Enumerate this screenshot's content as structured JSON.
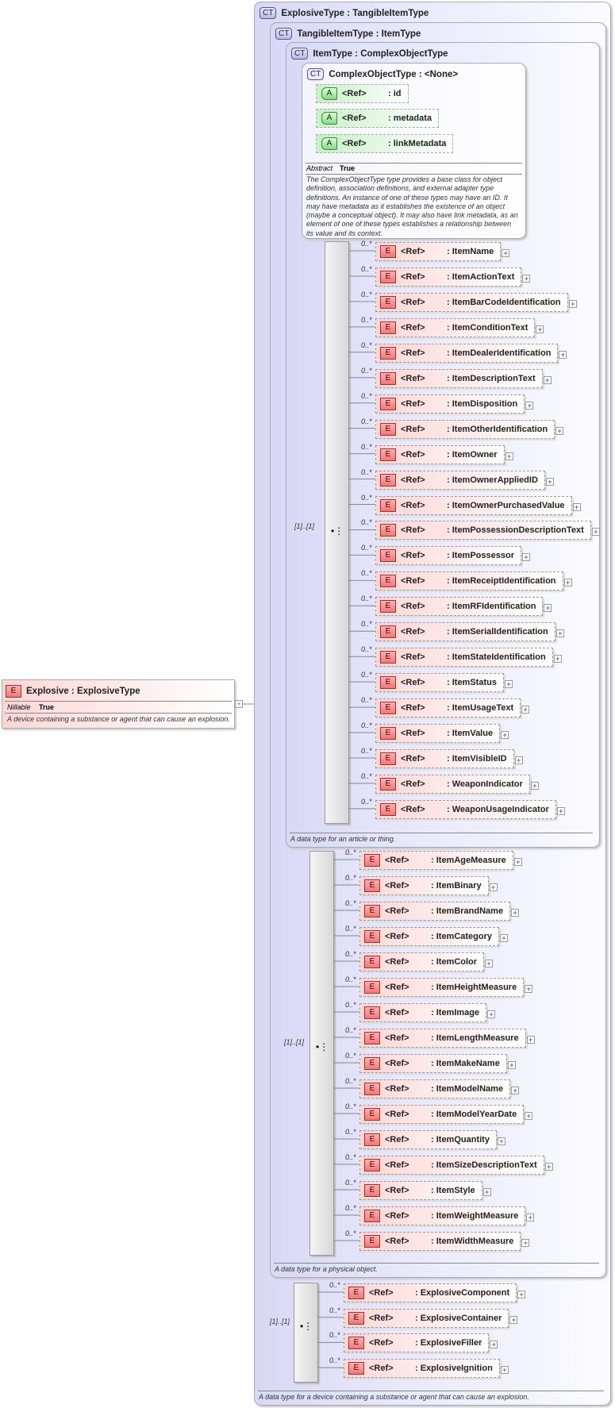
{
  "root_element": {
    "badge": "E",
    "name": "Explosive",
    "type": "ExplosiveType",
    "prop_label": "Nillable",
    "prop_value": "True",
    "description": "A device containing a substance or agent that can cause an explosion."
  },
  "explosive_type": {
    "badge": "CT",
    "title": "ExplosiveType : TangibleItemType",
    "description": "A data type for a device containing a substance or agent that can cause an explosion."
  },
  "tangible_item_type": {
    "badge": "CT",
    "title": "TangibleItemType : ItemType",
    "description": "A data type for a physical object."
  },
  "item_type": {
    "badge": "CT",
    "title": "ItemType : ComplexObjectType",
    "description": "A data type for an article or thing."
  },
  "complex_object_type": {
    "badge": "CT",
    "title": "ComplexObjectType : <None>",
    "prop_label": "Abstract",
    "prop_value": "True",
    "description": "The ComplexObjectType type provides a base class for object definition, association definitions, and external adapter type definitions. An instance of one of these types may have an ID. It may have metadata as it establishes the existence of an object (maybe a conceptual object). It may also have link metadata, as an element of one of these types establishes a relationship between its value and its context.",
    "attributes": [
      {
        "badge": "A",
        "ref": "<Ref>",
        "name": ": id"
      },
      {
        "badge": "A",
        "ref": "<Ref>",
        "name": ": metadata"
      },
      {
        "badge": "A",
        "ref": "<Ref>",
        "name": ": linkMetadata"
      }
    ]
  },
  "sequence_label": "[1]..[1]",
  "cardinality": "0..*",
  "ref_label": "<Ref>",
  "item_elements": [
    "ItemName",
    "ItemActionText",
    "ItemBarCodeIdentification",
    "ItemConditionText",
    "ItemDealerIdentification",
    "ItemDescriptionText",
    "ItemDisposition",
    "ItemOtherIdentification",
    "ItemOwner",
    "ItemOwnerAppliedID",
    "ItemOwnerPurchasedValue",
    "ItemPossessionDescriptionText",
    "ItemPossessor",
    "ItemReceiptIdentification",
    "ItemRFIdentification",
    "ItemSerialIdentification",
    "ItemStateIdentification",
    "ItemStatus",
    "ItemUsageText",
    "ItemValue",
    "ItemVisibleID",
    "WeaponIndicator",
    "WeaponUsageIndicator"
  ],
  "tangible_elements": [
    "ItemAgeMeasure",
    "ItemBinary",
    "ItemBrandName",
    "ItemCategory",
    "ItemColor",
    "ItemHeightMeasure",
    "ItemImage",
    "ItemLengthMeasure",
    "ItemMakeName",
    "ItemModelName",
    "ItemModelYearDate",
    "ItemQuantity",
    "ItemSizeDescriptionText",
    "ItemStyle",
    "ItemWeightMeasure",
    "ItemWidthMeasure"
  ],
  "explosive_elements": [
    "ExplosiveComponent",
    "ExplosiveContainer",
    "ExplosiveFiller",
    "ExplosiveIgnition"
  ],
  "colors": {
    "element": "#f07878",
    "attribute": "#88d888",
    "complex_type": "#b8b8e8"
  }
}
